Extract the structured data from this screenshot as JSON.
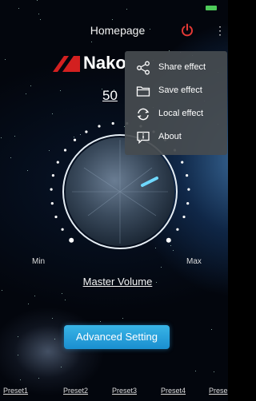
{
  "header": {
    "title": "Homepage",
    "power_icon": "power-icon",
    "more_icon": "more-vertical-icon",
    "accent_color": "#e53935"
  },
  "brand": {
    "logo_text": "Nako"
  },
  "volume": {
    "readout": "50",
    "min_label": "Min",
    "max_label": "Max",
    "master_label": "Master Volume"
  },
  "advanced_button": {
    "label": "Advanced Setting",
    "color": "#1a9fe0"
  },
  "presets": [
    "Preset1",
    "Preset2",
    "Preset3",
    "Preset4",
    "Prese"
  ],
  "menu": {
    "items": [
      {
        "label": "Share effect",
        "icon": "share-icon"
      },
      {
        "label": "Save effect",
        "icon": "folder-icon"
      },
      {
        "label": "Local effect",
        "icon": "refresh-icon"
      },
      {
        "label": "About",
        "icon": "info-icon"
      }
    ]
  }
}
